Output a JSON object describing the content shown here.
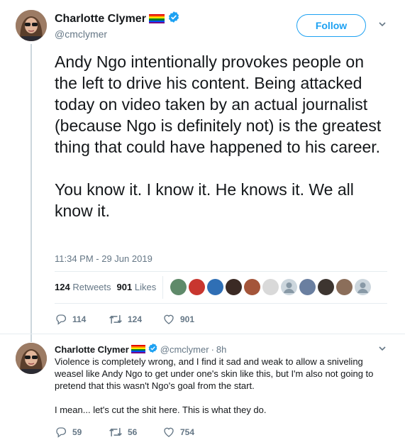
{
  "tweet": {
    "display_name": "Charlotte Clymer",
    "handle": "@cmclymer",
    "follow_label": "Follow",
    "text": "Andy Ngo intentionally provokes people on the left to drive his content. Being attacked today on video taken by an actual journalist (because Ngo is definitely not) is the greatest thing that could have happened to his career.\n\nYou know it. I know it. He knows it. We all know it.",
    "timestamp": "11:34 PM - 29 Jun 2019",
    "retweets_count": "124",
    "retweets_label": "Retweets",
    "likes_count": "901",
    "likes_label": "Likes",
    "actions": {
      "replies": "114",
      "retweets": "124",
      "likes": "901"
    }
  },
  "reply": {
    "display_name": "Charlotte Clymer",
    "handle": "@cmclymer",
    "separator": "·",
    "time": "8h",
    "text": "Violence is completely wrong, and I find it sad and weak to allow a sniveling weasel like Andy Ngo to get under one's skin like this, but I'm also not going to pretend that this wasn't Ngo's goal from the start.\n\nI mean... let's cut the shit here. This is what they do.",
    "actions": {
      "replies": "59",
      "retweets": "56",
      "likes": "754"
    }
  },
  "colors": {
    "accent": "#1da1f2",
    "muted": "#657786",
    "verified": "#1da1f2",
    "rainbow": [
      "#e40303",
      "#ff8c00",
      "#ffed00",
      "#008026",
      "#004dff",
      "#750787"
    ],
    "liker_avatars": [
      "#5f8a6a",
      "#c8362f",
      "#2f6fb5",
      "#3b2a24",
      "#a4553a",
      "#d9d9d9",
      "#ccd6dd",
      "#6a7fa0",
      "#3d3530",
      "#8b6e5a",
      "#ccd6dd"
    ]
  }
}
